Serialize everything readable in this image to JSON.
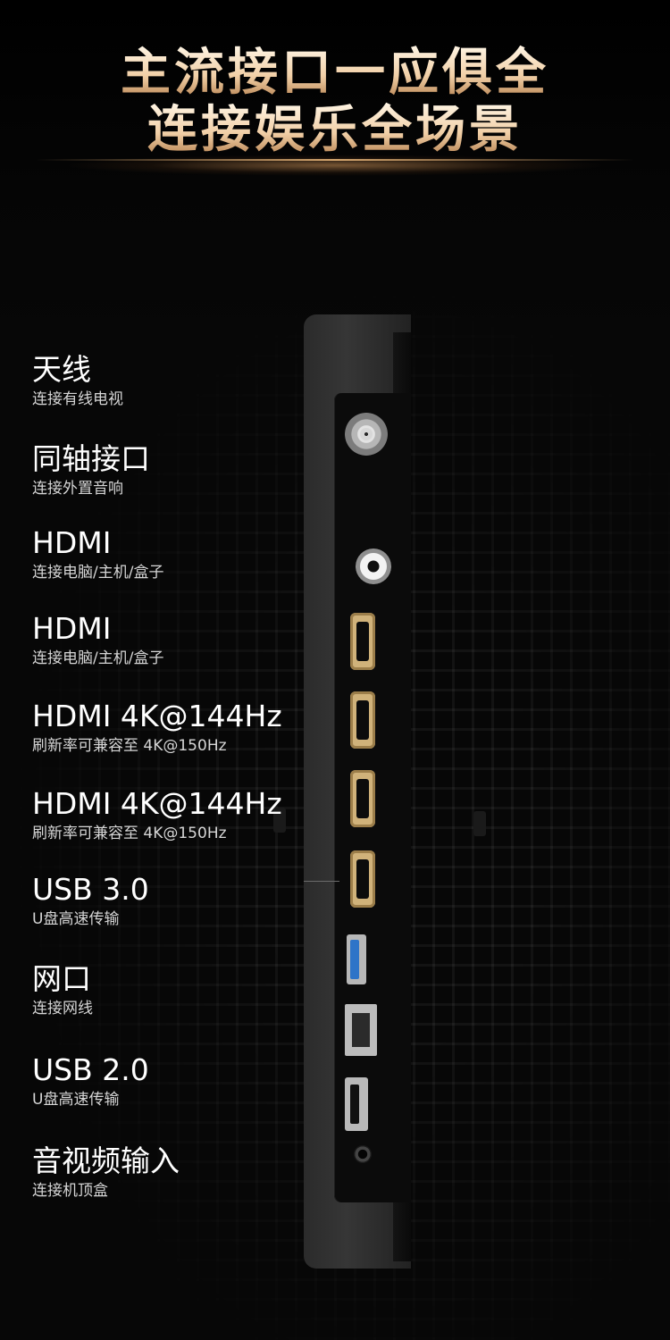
{
  "headline": {
    "line1": "主流接口一应俱全",
    "line2": "连接娱乐全场景"
  },
  "ports": [
    {
      "title": "天线",
      "subtitle": "连接有线电视"
    },
    {
      "title": "同轴接口",
      "subtitle": "连接外置音响"
    },
    {
      "title": "HDMI",
      "subtitle": "连接电脑/主机/盒子"
    },
    {
      "title": "HDMI",
      "subtitle": "连接电脑/主机/盒子"
    },
    {
      "title": "HDMI 4K@144Hz",
      "subtitle": "刷新率可兼容至 4K@150Hz"
    },
    {
      "title": "HDMI 4K@144Hz",
      "subtitle": "刷新率可兼容至 4K@150Hz"
    },
    {
      "title": "USB 3.0",
      "subtitle": "U盘高速传输"
    },
    {
      "title": "网口",
      "subtitle": "连接网线"
    },
    {
      "title": "USB 2.0",
      "subtitle": "U盘高速传输"
    },
    {
      "title": "音视频输入",
      "subtitle": "连接机顶盒"
    }
  ],
  "colors": {
    "headline_gold": "#f1cfa6",
    "hdmi_port": "#d0b27a",
    "usb3_blue": "#2e74c8",
    "background": "#070707"
  }
}
